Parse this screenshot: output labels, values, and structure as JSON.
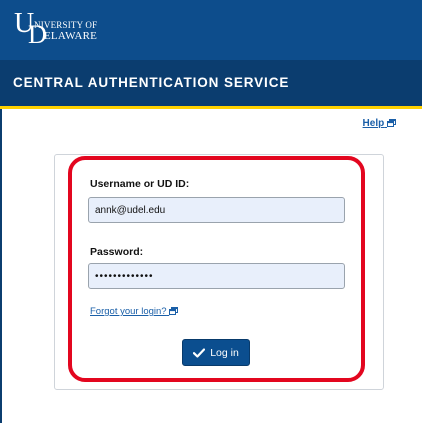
{
  "brand": {
    "logo_line1": "NIVERSITY OF",
    "logo_line2": "ELAWARE",
    "logo_initial_u": "U",
    "logo_initial_d": "D"
  },
  "header": {
    "title": "CENTRAL AUTHENTICATION SERVICE"
  },
  "help": {
    "label": "Help",
    "icon": "external-window-icon"
  },
  "form": {
    "username_label": "Username or UD ID:",
    "username_value": "annk@udel.edu",
    "password_label": "Password:",
    "password_masked": "•••••••••••••",
    "forgot_label": "Forgot your login?",
    "forgot_icon": "external-window-icon",
    "login_label": "Log in",
    "login_icon": "checkmark-icon"
  },
  "colors": {
    "brand_blue": "#0d4d8c",
    "header_blue": "#0b3d6f",
    "accent_gold": "#ffd200",
    "highlight_red": "#e3061f",
    "link_blue": "#1a5fa8",
    "input_bg": "#e8effb"
  }
}
